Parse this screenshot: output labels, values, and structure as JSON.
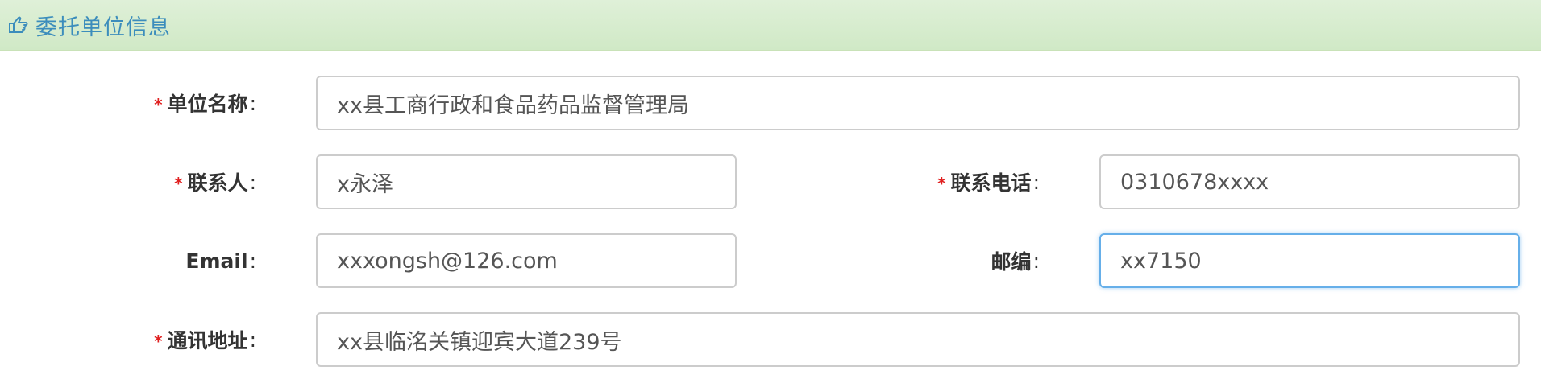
{
  "header": {
    "icon": "hand-point-right-icon",
    "title": "委托单位信息"
  },
  "form": {
    "unit_name": {
      "label": "单位名称",
      "required": "*",
      "colon": ":",
      "value": "xx县工商行政和食品药品监督管理局"
    },
    "contact": {
      "label": "联系人",
      "required": "*",
      "colon": ":",
      "value": "x永泽"
    },
    "phone": {
      "label": "联系电话",
      "required": "*",
      "colon": ":",
      "value": "0310678xxxx"
    },
    "email": {
      "label": "Email",
      "colon": ":",
      "value": "xxxongsh@126.com"
    },
    "postcode": {
      "label": "邮编",
      "colon": ":",
      "value": "xx7150"
    },
    "address": {
      "label": "通讯地址",
      "required": "*",
      "colon": ":",
      "value": "xx县临洺关镇迎宾大道239号"
    }
  },
  "colors": {
    "header_bg": "#dff0d8",
    "header_text": "#3c8dbc",
    "required": "#e02020",
    "focus_border": "#66afe9"
  }
}
